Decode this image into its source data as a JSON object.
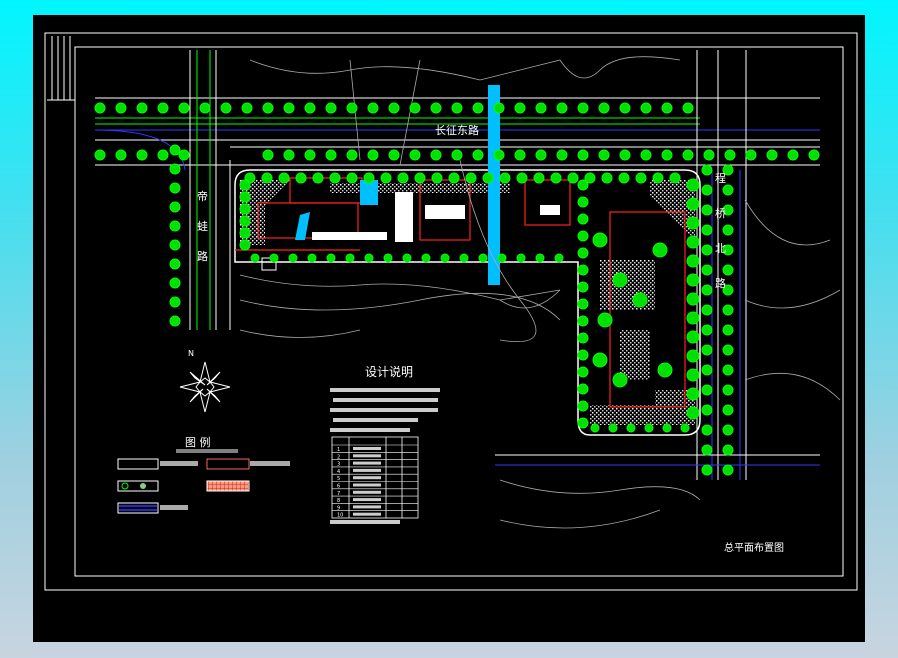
{
  "drawing": {
    "title": "总平面布置图",
    "notes_title": "设计说明",
    "legend_title": "图 例",
    "north_label": "N",
    "roads": {
      "top": "长征东路",
      "left": [
        "帝",
        "蛙",
        "路"
      ],
      "right": [
        "程",
        "桥",
        "北",
        "路"
      ]
    },
    "colors": {
      "background": "#000000",
      "frame": "#ffffff",
      "trees": "#00ff00",
      "buildings": "#ff2020",
      "water": "#00bfff",
      "road_edges": "#3030ff"
    },
    "notes_table_rows": [
      "1",
      "2",
      "3",
      "4",
      "5",
      "6",
      "7",
      "8",
      "9",
      "10"
    ]
  }
}
